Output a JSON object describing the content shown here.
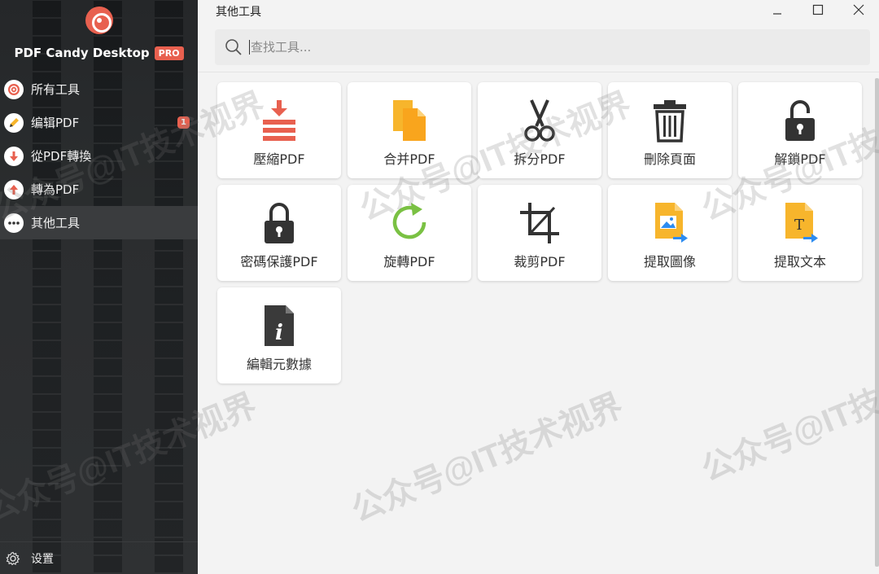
{
  "app": {
    "brand": "PDF Candy Desktop",
    "badge": "PRO"
  },
  "sidebar": {
    "items": [
      {
        "label": "所有工具",
        "icon": "lollipop-icon"
      },
      {
        "label": "编辑PDF",
        "icon": "pencil-icon",
        "badge": "1"
      },
      {
        "label": "從PDF轉換",
        "icon": "arrow-down-icon"
      },
      {
        "label": "轉為PDF",
        "icon": "arrow-up-icon"
      },
      {
        "label": "其他工具",
        "icon": "more-dots-icon",
        "active": true
      }
    ],
    "settings_label": "设置"
  },
  "window": {
    "title": "其他工具"
  },
  "search": {
    "placeholder": "查找工具..."
  },
  "tools": [
    {
      "label": "壓縮PDF",
      "icon": "compress-icon"
    },
    {
      "label": "合并PDF",
      "icon": "merge-icon"
    },
    {
      "label": "拆分PDF",
      "icon": "scissors-icon"
    },
    {
      "label": "刪除頁面",
      "icon": "trash-icon"
    },
    {
      "label": "解鎖PDF",
      "icon": "unlock-icon"
    },
    {
      "label": "密碼保護PDF",
      "icon": "lock-icon"
    },
    {
      "label": "旋轉PDF",
      "icon": "rotate-icon"
    },
    {
      "label": "裁剪PDF",
      "icon": "crop-icon"
    },
    {
      "label": "提取圖像",
      "icon": "extract-image-icon"
    },
    {
      "label": "提取文本",
      "icon": "extract-text-icon"
    },
    {
      "label": "編輯元數據",
      "icon": "metadata-icon"
    }
  ],
  "watermark": "公众号@IT技术视界",
  "colors": {
    "accent": "#e8604f",
    "sidebar_bg": "#1d2022",
    "yellow": "#f7b52c",
    "green": "#7ac143",
    "blue": "#2d8cf0"
  }
}
